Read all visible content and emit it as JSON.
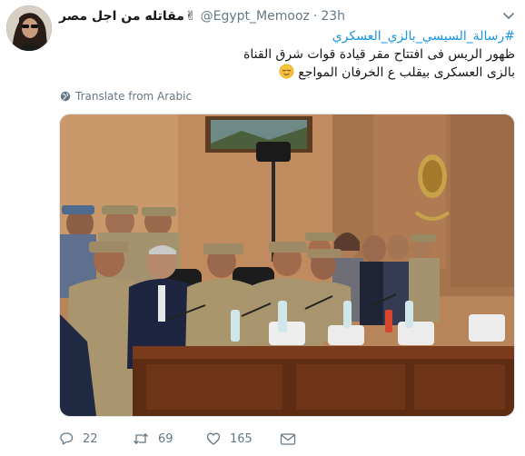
{
  "tweet": {
    "display_name": "مقاتله من اجل مصر",
    "victory_emoji": "✌",
    "handle": "@Egypt_Memooz",
    "separator": "·",
    "time": "23h",
    "hashtag": "#رسالة_السيسي_بالزي_العسكري",
    "line1": "ظهور الريس فى افتتاح مقر قيادة قوات شرق القناة",
    "line2": "بالزى العسكرى بيقلب ع الخرفان المواجع",
    "translate_label": "Translate from Arabic",
    "actions": {
      "reply_count": "22",
      "retweet_count": "69",
      "like_count": "165"
    }
  },
  "icons": {
    "more": "chevron-down-icon",
    "translate": "globe-icon",
    "reply": "reply-icon",
    "retweet": "retweet-icon",
    "like": "heart-icon",
    "dm": "envelope-icon",
    "emoji": "relieved-face-emoji-icon"
  },
  "colors": {
    "link": "#1b95e0",
    "muted": "#657786",
    "text": "#14171a"
  }
}
